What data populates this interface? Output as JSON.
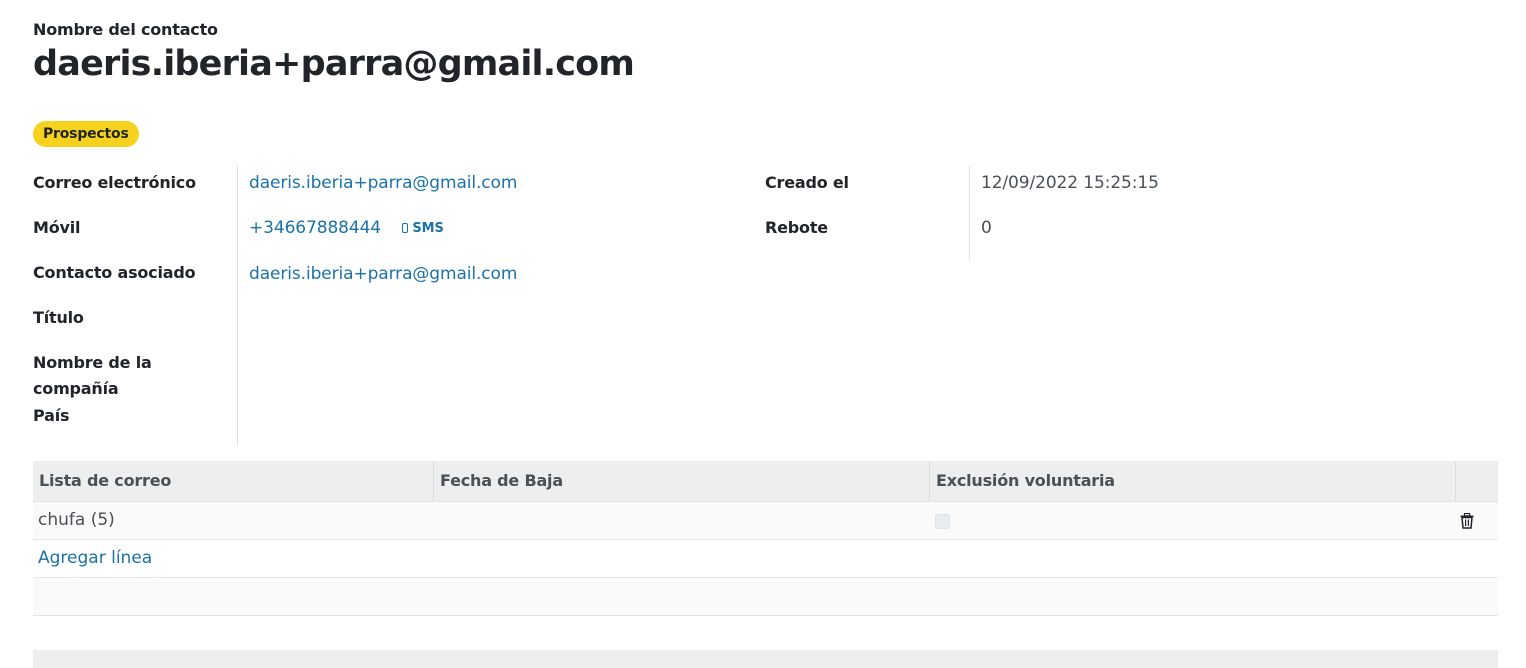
{
  "header": {
    "contact_label": "Nombre del contacto",
    "contact_name": "daeris.iberia+parra@gmail.com",
    "tag": "Prospectos",
    "tag_color": "#f6d21f"
  },
  "fields_left": {
    "email_label": "Correo electrónico",
    "email_value": "daeris.iberia+parra@gmail.com",
    "mobile_label": "Móvil",
    "mobile_value": "+34667888444",
    "sms_label": "SMS",
    "partner_label": "Contacto asociado",
    "partner_value": "daeris.iberia+parra@gmail.com",
    "title_label": "Título",
    "company_label_line1": "Nombre de la",
    "company_label_line2": "compañía",
    "country_label": "País"
  },
  "fields_right": {
    "created_label": "Creado el",
    "created_value": "12/09/2022 15:25:15",
    "bounce_label": "Rebote",
    "bounce_value": "0"
  },
  "table": {
    "columns": [
      "Lista de correo",
      "Fecha de Baja",
      "Exclusión voluntaria"
    ],
    "rows": [
      {
        "mailing_list": "chufa (5)",
        "unsubscription_date": "",
        "opt_out": false
      }
    ],
    "add_line_label": "Agregar línea"
  },
  "colors": {
    "link": "#1a72a8",
    "text": "#212529",
    "header_bg": "#eeeeee"
  },
  "icons": {
    "sms": "mobile-phone-icon",
    "delete": "trash-icon"
  }
}
